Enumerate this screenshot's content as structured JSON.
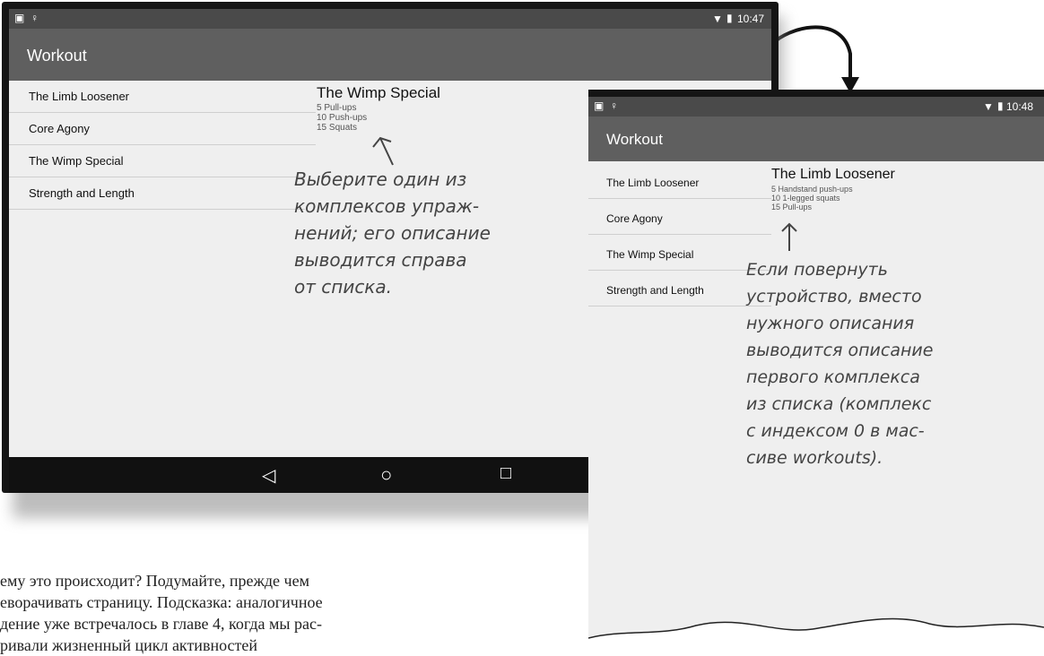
{
  "landscape": {
    "status_time": "10:47",
    "app_title": "Workout",
    "list": [
      "The Limb Loosener",
      "Core Agony",
      "The Wimp Special",
      "Strength and Length"
    ],
    "detail": {
      "title": "The Wimp Special",
      "lines": [
        "5 Pull-ups",
        "10 Push-ups",
        "15 Squats"
      ]
    },
    "annotation": "Выберите один из комплексов упраж- нений; его описание выводится справа от списка.",
    "annotation_lines": [
      "Выберите один из",
      "комплексов упраж-",
      "нений; его описание",
      "выводится справа",
      "от списка."
    ],
    "nav": {
      "back": "◁",
      "home": "○",
      "recents": "□"
    }
  },
  "portrait": {
    "status_time": "10:48",
    "app_title": "Workout",
    "list": [
      "The Limb Loosener",
      "Core Agony",
      "The Wimp Special",
      "Strength and Length"
    ],
    "detail": {
      "title": "The Limb Loosener",
      "lines": [
        "5 Handstand push-ups",
        "10 1-legged squats",
        "15 Pull-ups"
      ]
    },
    "annotation_lines": [
      "Если повернуть",
      "устройство, вместо",
      "нужного описания",
      "выводится описание",
      "первого комплекса",
      "из списка (комплекс",
      "с индексом 0 в мас-",
      "сиве workouts)."
    ]
  },
  "caption_lines": [
    "ему это происходит? Подумайте, прежде чем",
    "еворачивать страницу. Подсказка: аналогичное",
    "дение уже встречалось в главе 4, когда мы рас-",
    "ривали жизненный цикл активностей"
  ],
  "icons": [
    "wifi-icon",
    "battery-icon",
    "sim-icon",
    "notification-icon",
    "curved-arrow-icon",
    "hand-arrow-icon"
  ]
}
